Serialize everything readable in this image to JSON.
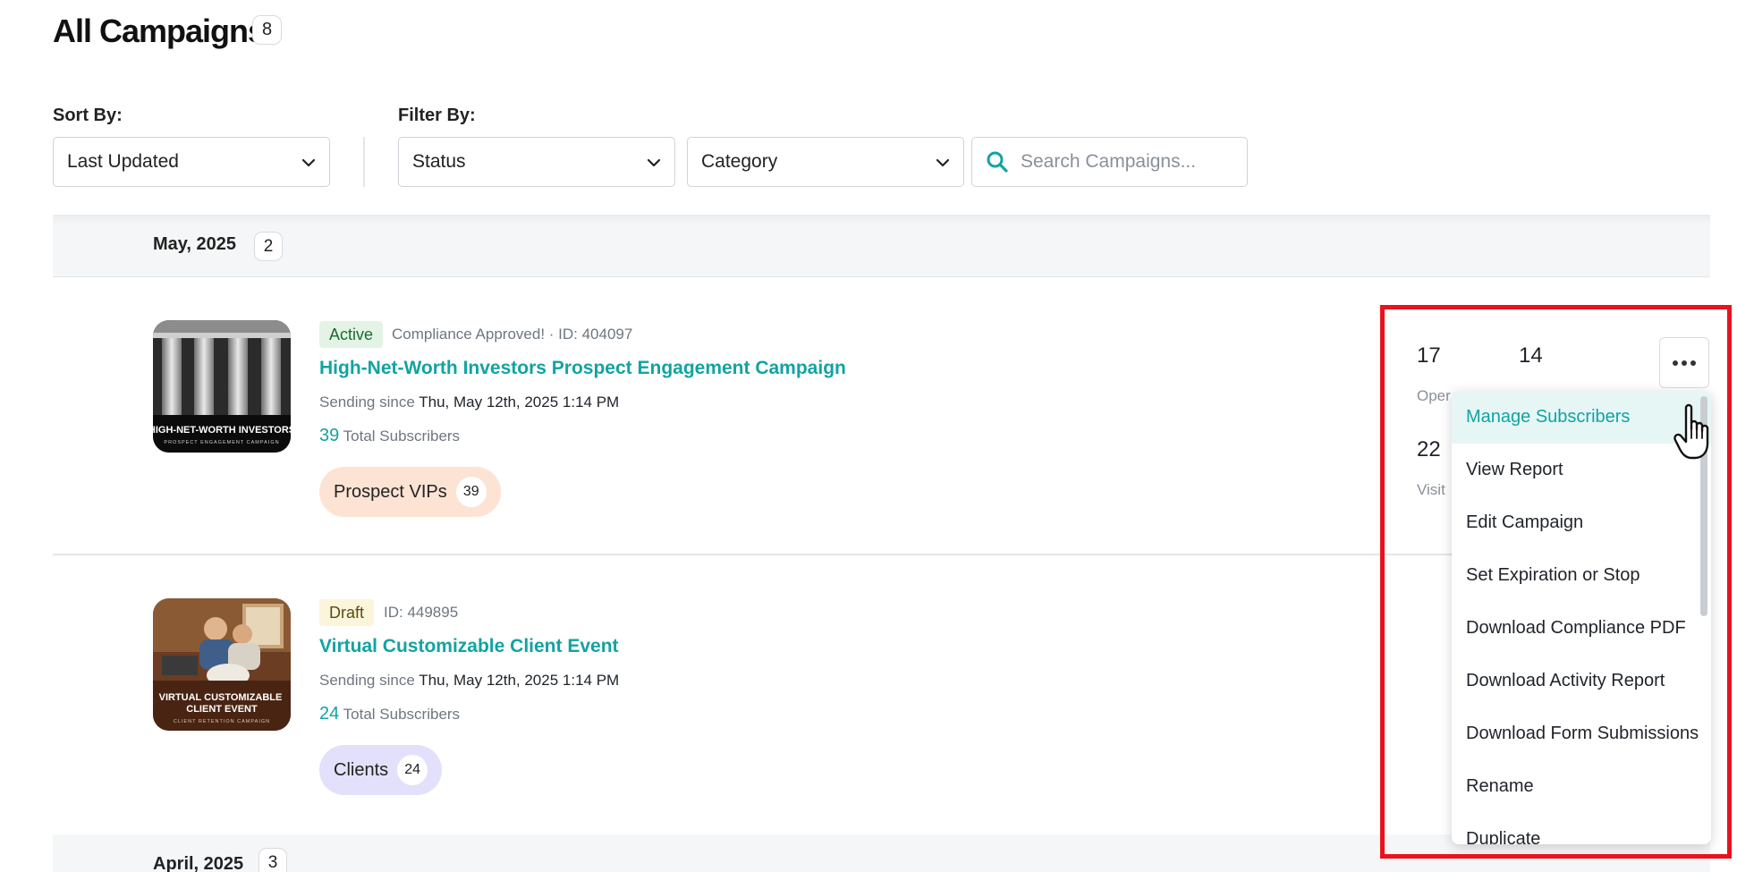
{
  "header": {
    "title": "All Campaigns",
    "count": "8"
  },
  "controls": {
    "sort_label": "Sort By:",
    "sort_value": "Last Updated",
    "filter_label": "Filter By:",
    "status_value": "Status",
    "category_value": "Category",
    "search_placeholder": "Search Campaigns..."
  },
  "groups": [
    {
      "label": "May, 2025",
      "count": "2"
    },
    {
      "label": "April, 2025",
      "count": "3"
    }
  ],
  "campaigns": [
    {
      "status": "Active",
      "meta": "Compliance Approved! · ID: 404097",
      "title": "High-Net-Worth Investors Prospect Engagement Campaign",
      "since_label": "Sending since",
      "since_value": "Thu, May 12th, 2025 1:14 PM",
      "subs_count": "39",
      "subs_label": "Total Subscribers",
      "tag_name": "Prospect VIPs",
      "tag_count": "39",
      "thumb_title": "HIGH-NET-WORTH INVESTORS",
      "thumb_sub": "PROSPECT ENGAGEMENT CAMPAIGN",
      "stats": [
        {
          "value": "17",
          "label": "Oper"
        },
        {
          "value": "14",
          "label": ""
        },
        {
          "value": "22",
          "label": "Visit"
        }
      ]
    },
    {
      "status": "Draft",
      "meta": "ID: 449895",
      "title": "Virtual Customizable Client Event",
      "since_label": "Sending since",
      "since_value": "Thu, May 12th, 2025 1:14 PM",
      "subs_count": "24",
      "subs_label": "Total Subscribers",
      "tag_name": "Clients",
      "tag_count": "24",
      "thumb_title": "VIRTUAL CUSTOMIZABLE CLIENT EVENT",
      "thumb_sub": "CLIENT RETENTION CAMPAIGN"
    }
  ],
  "menu": {
    "items": [
      "Manage Subscribers",
      "View Report",
      "Edit Campaign",
      "Set Expiration or Stop",
      "Download Compliance PDF",
      "Download Activity Report",
      "Download Form Submissions",
      "Rename",
      "Duplicate"
    ]
  },
  "colors": {
    "accent": "#12a3a3",
    "active_pill_bg": "#e3f3e6",
    "draft_pill_bg": "#fbf5dc",
    "tag_prospect_bg": "#fde3d3",
    "tag_clients_bg": "#e3e0fb",
    "highlight": "#e8131f"
  }
}
